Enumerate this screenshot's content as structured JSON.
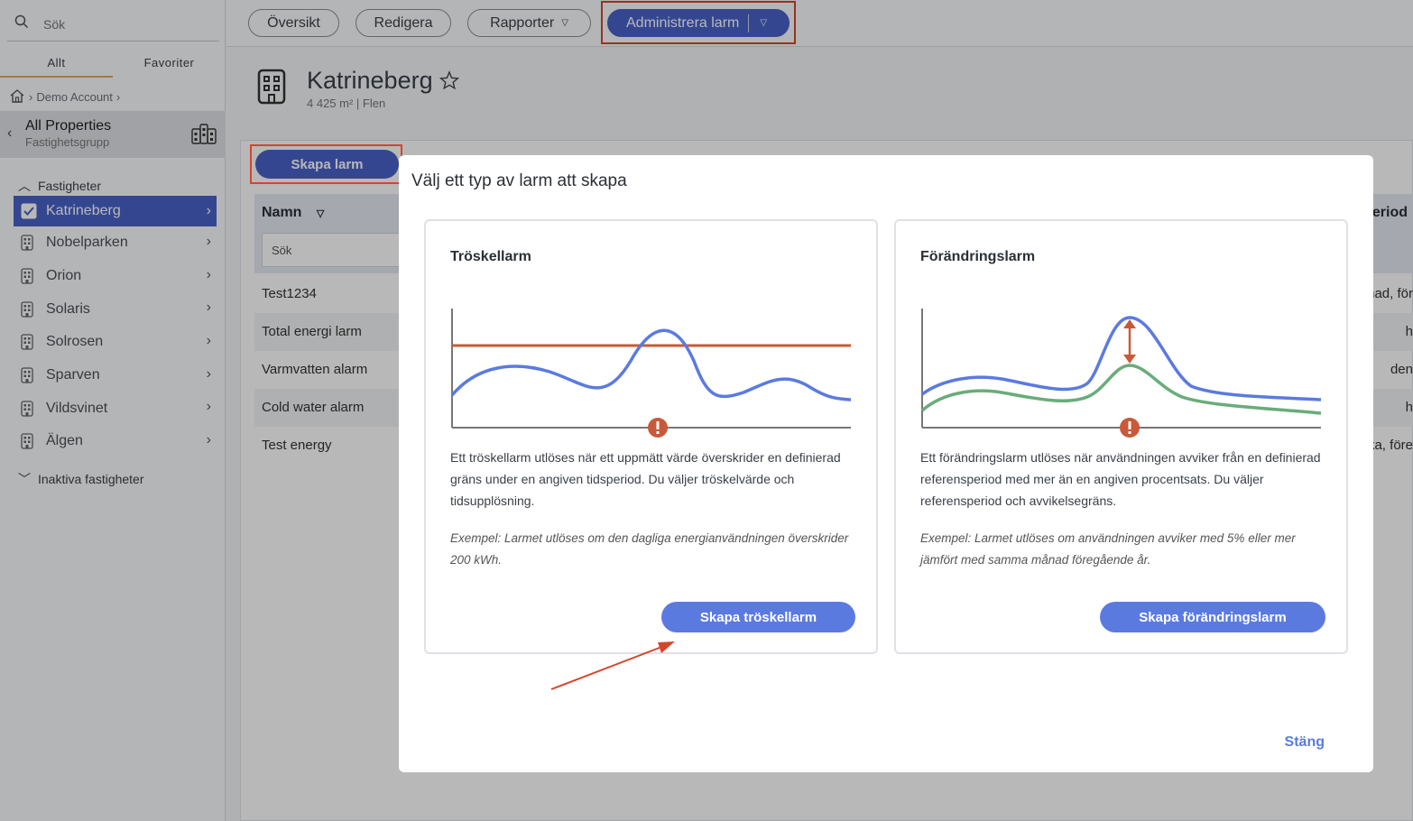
{
  "sidebar": {
    "search_placeholder": "Sök",
    "tabs": [
      "Allt",
      "Favoriter"
    ],
    "breadcrumb": "Demo Account",
    "group": {
      "title": "All Properties",
      "subtitle": "Fastighetsgrupp"
    },
    "section_label": "Fastigheter",
    "properties": [
      "Katrineberg",
      "Nobelparken",
      "Orion",
      "Solaris",
      "Solrosen",
      "Sparven",
      "Vildsvinet",
      "Älgen"
    ],
    "inactive_label": "Inaktiva fastigheter"
  },
  "topbar": {
    "buttons": [
      "Översikt",
      "Redigera",
      "Rapporter",
      "Administrera larm"
    ]
  },
  "property": {
    "name": "Katrineberg",
    "subtitle": "4 425 m² | Flen"
  },
  "alarms": {
    "create_label": "Skapa larm",
    "col_name": "Namn",
    "col_period": "eriod",
    "search_placeholder": "Sök",
    "rows": [
      {
        "name": "Test1234",
        "period": "nad, för"
      },
      {
        "name": "Total energi larm",
        "period": "h"
      },
      {
        "name": "Varmvatten alarm",
        "period": "den"
      },
      {
        "name": "Cold water alarm",
        "period": "h"
      },
      {
        "name": "Test energy",
        "period": "ka, före"
      }
    ]
  },
  "modal": {
    "title": "Välj ett typ av larm att skapa",
    "threshold": {
      "title": "Tröskellarm",
      "description": "Ett tröskellarm utlöses när ett uppmätt värde överskrider en definierad gräns under en angiven tidsperiod. Du väljer tröskelvärde och tidsupplösning.",
      "example": "Exempel: Larmet utlöses om den dagliga energianvändningen överskrider 200 kWh.",
      "button": "Skapa tröskellarm"
    },
    "change": {
      "title": "Förändringslarm",
      "description": "Ett förändringslarm utlöses när användningen avviker från en definierad referensperiod med mer än en angiven procentsats. Du väljer referensperiod och avvikelsegräns.",
      "example": "Exempel: Larmet utlöses om användningen avviker med 5% eller mer jämfört med samma månad föregående år.",
      "button": "Skapa förändringslarm"
    },
    "close": "Stäng"
  },
  "colors": {
    "primary": "#4a61c9",
    "button": "#5b7ae0",
    "highlight": "#d4462b",
    "threshold_line": "#c85a3a",
    "curve_blue": "#5b7ae0",
    "curve_green": "#6aac7a"
  }
}
